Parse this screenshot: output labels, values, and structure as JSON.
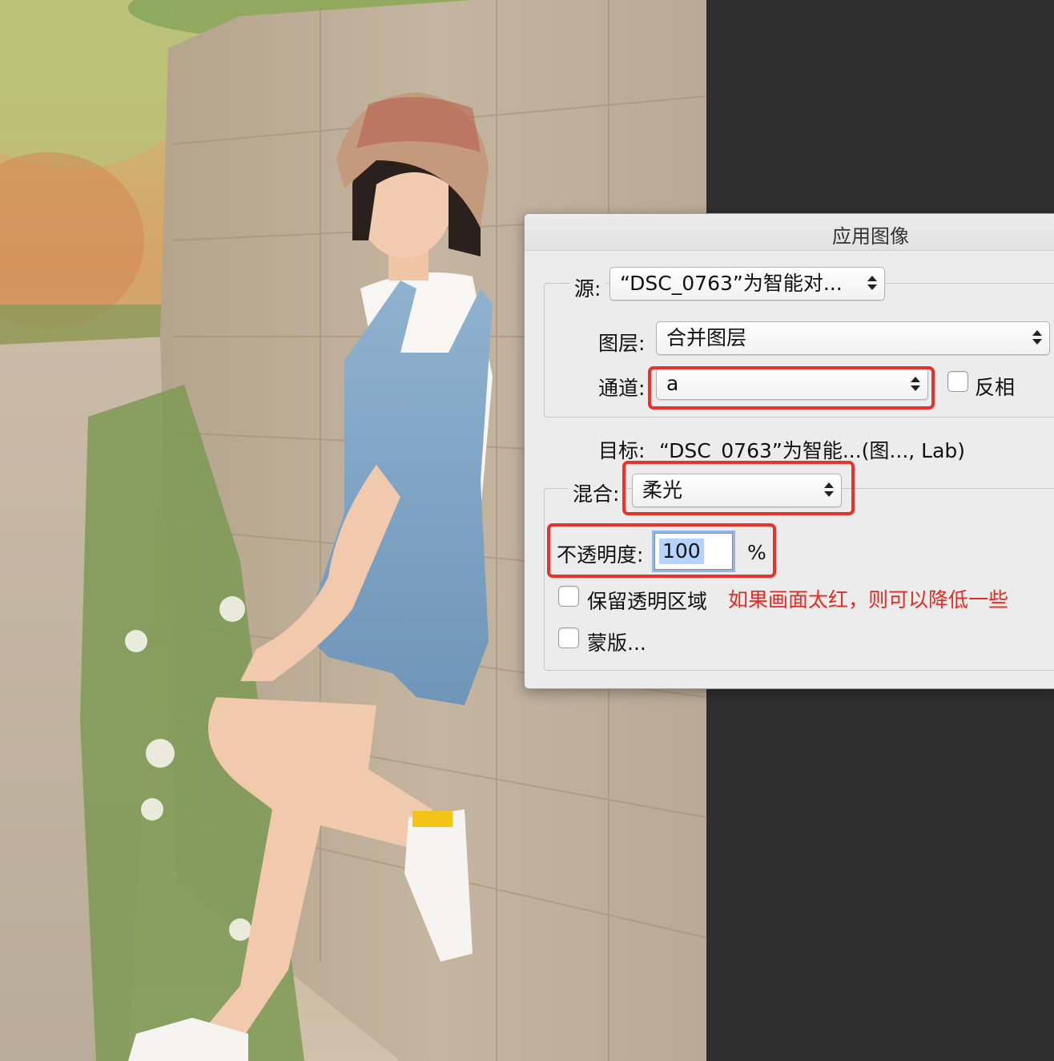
{
  "dialog": {
    "title": "应用图像",
    "source": {
      "label": "源:",
      "value": "“DSC_0763”为智能对..."
    },
    "layer": {
      "label": "图层:",
      "value": "合并图层"
    },
    "channel": {
      "label": "通道:",
      "value": "a"
    },
    "invert": {
      "label": "反相",
      "checked": false
    },
    "target": {
      "label": "目标:",
      "value": "“DSC_0763”为智能...(图..., Lab)"
    },
    "blending": {
      "label": "混合:",
      "value": "柔光"
    },
    "opacity": {
      "label": "不透明度:",
      "value": "100",
      "unit": "%"
    },
    "preserve_transparency": {
      "label": "保留透明区域",
      "checked": false
    },
    "mask": {
      "label": "蒙版...",
      "checked": false
    }
  },
  "annotation": "如果画面太红，则可以降低一些",
  "colors": {
    "highlight_red": "#e8322a",
    "annotation_red": "#e52b23",
    "workspace": "#2f2f2f"
  },
  "photo": {
    "alt": ""
  }
}
